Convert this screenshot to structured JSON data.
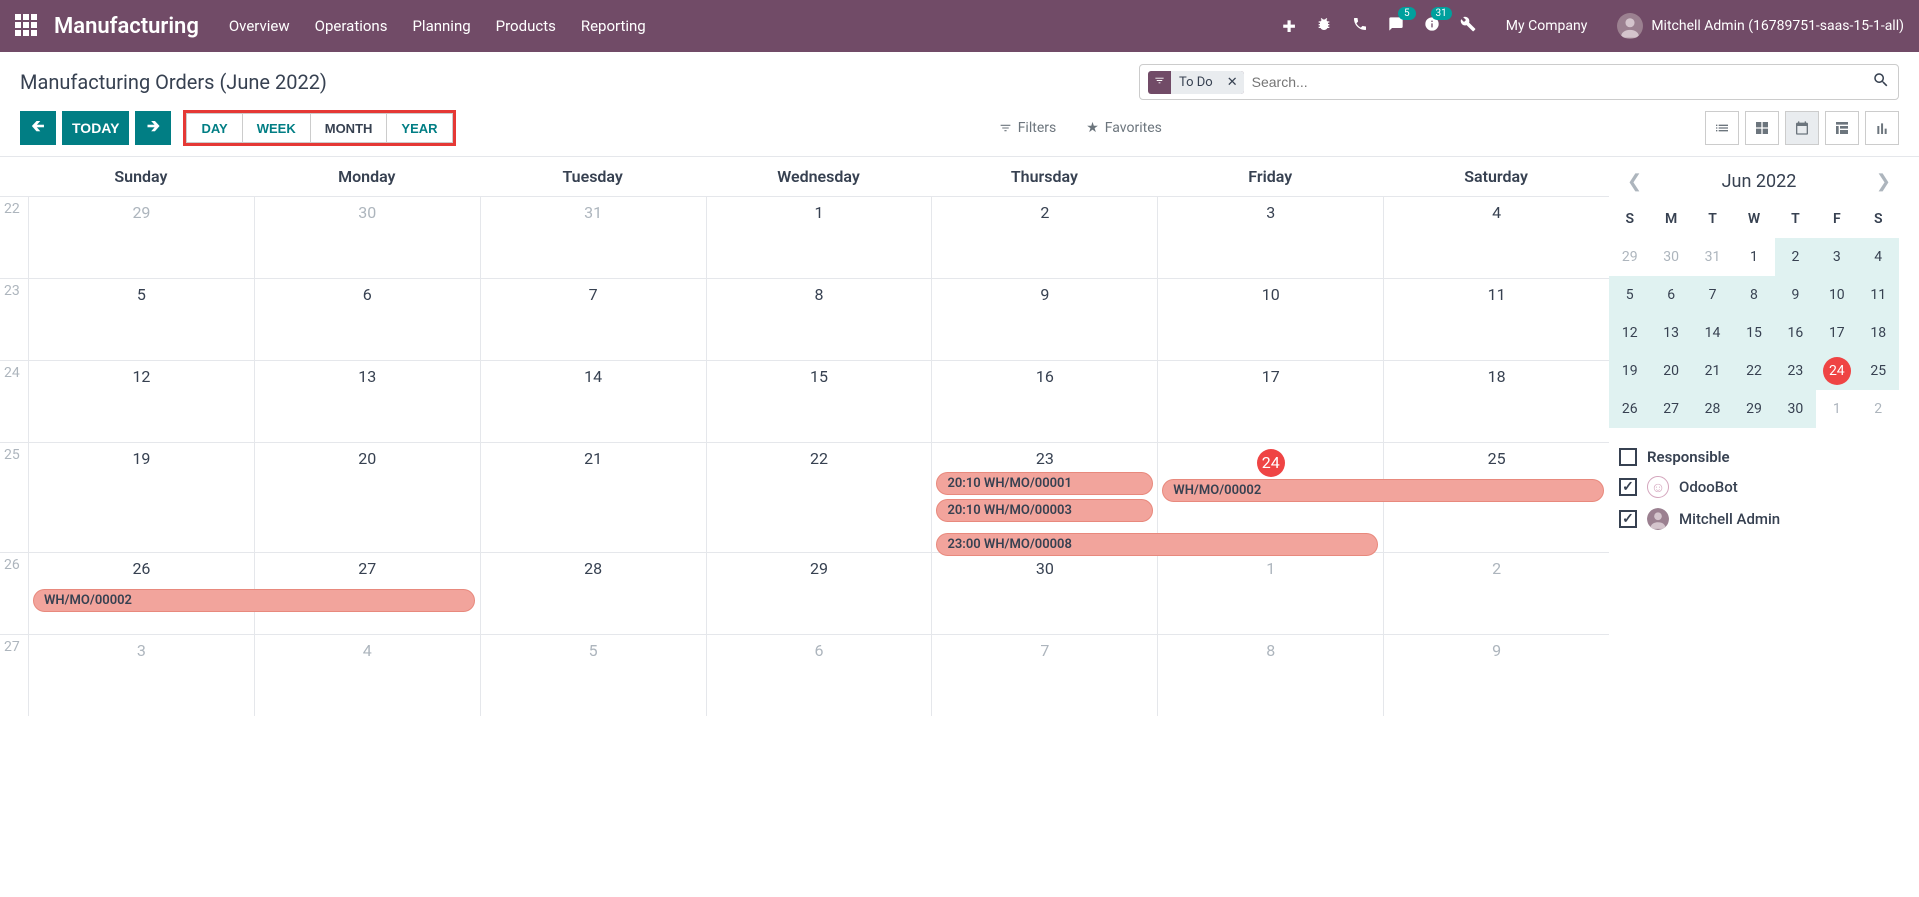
{
  "topnav": {
    "brand": "Manufacturing",
    "menu": [
      "Overview",
      "Operations",
      "Planning",
      "Products",
      "Reporting"
    ],
    "badges": {
      "messages": "5",
      "activities": "31"
    },
    "company": "My Company",
    "user": "Mitchell Admin (16789751-saas-15-1-all)"
  },
  "header": {
    "title": "Manufacturing Orders (June 2022)",
    "filter_chip": "To Do",
    "search_placeholder": "Search..."
  },
  "toolbar": {
    "today": "TODAY",
    "scales": [
      "DAY",
      "WEEK",
      "MONTH",
      "YEAR"
    ],
    "active_scale": "MONTH",
    "filters_label": "Filters",
    "favorites_label": "Favorites"
  },
  "calendar": {
    "day_names": [
      "Sunday",
      "Monday",
      "Tuesday",
      "Wednesday",
      "Thursday",
      "Friday",
      "Saturday"
    ],
    "weeks": [
      {
        "wk": "22",
        "days": [
          {
            "n": "29",
            "out": true
          },
          {
            "n": "30",
            "out": true
          },
          {
            "n": "31",
            "out": true
          },
          {
            "n": "1"
          },
          {
            "n": "2"
          },
          {
            "n": "3"
          },
          {
            "n": "4"
          }
        ]
      },
      {
        "wk": "23",
        "days": [
          {
            "n": "5"
          },
          {
            "n": "6"
          },
          {
            "n": "7"
          },
          {
            "n": "8"
          },
          {
            "n": "9"
          },
          {
            "n": "10"
          },
          {
            "n": "11"
          }
        ]
      },
      {
        "wk": "24",
        "days": [
          {
            "n": "12"
          },
          {
            "n": "13"
          },
          {
            "n": "14"
          },
          {
            "n": "15"
          },
          {
            "n": "16"
          },
          {
            "n": "17"
          },
          {
            "n": "18"
          }
        ]
      },
      {
        "wk": "25",
        "days": [
          {
            "n": "19"
          },
          {
            "n": "20"
          },
          {
            "n": "21"
          },
          {
            "n": "22"
          },
          {
            "n": "23"
          },
          {
            "n": "24",
            "today": true
          },
          {
            "n": "25"
          }
        ]
      },
      {
        "wk": "26",
        "days": [
          {
            "n": "26"
          },
          {
            "n": "27"
          },
          {
            "n": "28"
          },
          {
            "n": "29"
          },
          {
            "n": "30"
          },
          {
            "n": "1",
            "out": true
          },
          {
            "n": "2",
            "out": true
          }
        ]
      },
      {
        "wk": "27",
        "days": [
          {
            "n": "3",
            "out": true
          },
          {
            "n": "4",
            "out": true
          },
          {
            "n": "5",
            "out": true
          },
          {
            "n": "6",
            "out": true
          },
          {
            "n": "7",
            "out": true
          },
          {
            "n": "8",
            "out": true
          },
          {
            "n": "9",
            "out": true
          }
        ]
      }
    ],
    "events": {
      "e1": "20:10  WH/MO/00001",
      "e2": "20:10  WH/MO/00003",
      "e3": "23:00  WH/MO/00008",
      "e4": "WH/MO/00002",
      "e5": "WH/MO/00002"
    }
  },
  "sidebar": {
    "month_title": "Jun 2022",
    "dow": [
      "S",
      "M",
      "T",
      "W",
      "T",
      "F",
      "S"
    ],
    "rows": [
      [
        {
          "n": "29",
          "out": true
        },
        {
          "n": "30",
          "out": true
        },
        {
          "n": "31",
          "out": true
        },
        {
          "n": "1",
          "d1": true
        },
        {
          "n": "2"
        },
        {
          "n": "3"
        },
        {
          "n": "4"
        }
      ],
      [
        {
          "n": "5"
        },
        {
          "n": "6"
        },
        {
          "n": "7"
        },
        {
          "n": "8"
        },
        {
          "n": "9"
        },
        {
          "n": "10"
        },
        {
          "n": "11"
        }
      ],
      [
        {
          "n": "12"
        },
        {
          "n": "13"
        },
        {
          "n": "14"
        },
        {
          "n": "15"
        },
        {
          "n": "16"
        },
        {
          "n": "17"
        },
        {
          "n": "18"
        }
      ],
      [
        {
          "n": "19"
        },
        {
          "n": "20"
        },
        {
          "n": "21"
        },
        {
          "n": "22"
        },
        {
          "n": "23"
        },
        {
          "n": "24",
          "today": true
        },
        {
          "n": "25"
        }
      ],
      [
        {
          "n": "26"
        },
        {
          "n": "27"
        },
        {
          "n": "28"
        },
        {
          "n": "29"
        },
        {
          "n": "30"
        },
        {
          "n": "1",
          "out": true
        },
        {
          "n": "2",
          "out": true
        }
      ]
    ],
    "filter_title": "Responsible",
    "filter_items": [
      {
        "label": "OdooBot",
        "checked": true,
        "bot": true
      },
      {
        "label": "Mitchell Admin",
        "checked": true,
        "bot": false
      }
    ]
  }
}
